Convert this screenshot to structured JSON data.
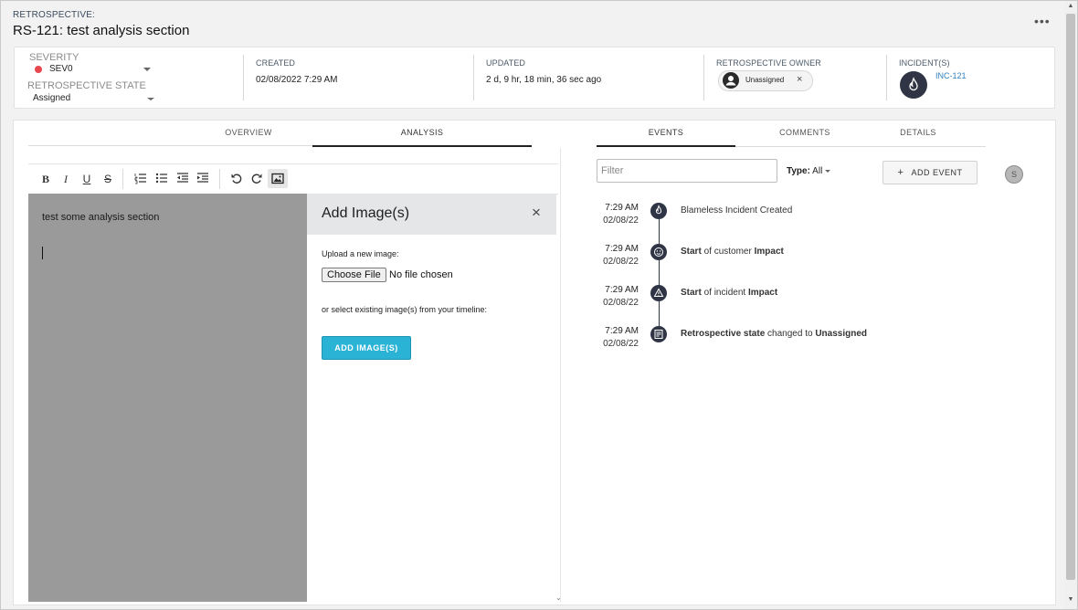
{
  "header": {
    "kicker": "RETROSPECTIVE:",
    "title": "RS-121: test analysis section",
    "more": "•••"
  },
  "info": {
    "severity_label": "SEVERITY",
    "severity_value": "SEV0",
    "state_label": "RETROSPECTIVE STATE",
    "state_value": "Assigned",
    "created_label": "CREATED",
    "created_value": "02/08/2022 7:29 AM",
    "updated_label": "UPDATED",
    "updated_value": "2 d, 9 hr, 18 min, 36 sec ago",
    "owner_label": "RETROSPECTIVE OWNER",
    "owner_value": "Unassigned",
    "owner_remove": "×",
    "incidents_label": "INCIDENT(S)",
    "incident_link": "INC-121"
  },
  "left_tabs": [
    "OVERVIEW",
    "ANALYSIS"
  ],
  "toolbar": {
    "bold": "B",
    "italic": "I",
    "underline": "U",
    "strike": "S"
  },
  "editor": {
    "text": "test some analysis section"
  },
  "add_image": {
    "title": "Add Image(s)",
    "close": "×",
    "upload_label": "Upload a new image:",
    "choose_button": "Choose File",
    "no_file": "No file chosen",
    "existing_label": "or select existing image(s) from your timeline:",
    "add_button": "ADD IMAGE(S)"
  },
  "right_tabs": [
    "EVENTS",
    "COMMENTS",
    "DETAILS"
  ],
  "events_toolbar": {
    "filter_placeholder": "Filter",
    "type_label": "Type:",
    "type_value": "All",
    "add_event": "ADD EVENT",
    "add_event_icon": "+",
    "user_initial": "S"
  },
  "events": [
    {
      "time": "7:29 AM",
      "date": "02/08/22",
      "icon": "flame-icon",
      "parts": [
        {
          "t": "Blameless Incident Created",
          "b": false
        }
      ]
    },
    {
      "time": "7:29 AM",
      "date": "02/08/22",
      "icon": "smiley-icon",
      "parts": [
        {
          "t": "Start",
          "b": true
        },
        {
          "t": " of customer ",
          "b": false
        },
        {
          "t": "Impact",
          "b": true
        }
      ]
    },
    {
      "time": "7:29 AM",
      "date": "02/08/22",
      "icon": "warning-icon",
      "parts": [
        {
          "t": "Start",
          "b": true
        },
        {
          "t": " of incident ",
          "b": false
        },
        {
          "t": "Impact",
          "b": true
        }
      ]
    },
    {
      "time": "7:29 AM",
      "date": "02/08/22",
      "icon": "note-icon",
      "parts": [
        {
          "t": "Retrospective state",
          "b": true
        },
        {
          "t": " changed to ",
          "b": false
        },
        {
          "t": "Unassigned",
          "b": true
        }
      ]
    }
  ],
  "colors": {
    "severity_dot": "#e8474f",
    "accent_button": "#2bb3d6",
    "link": "#2a7fc1",
    "event_icon_bg": "#2f3545"
  }
}
